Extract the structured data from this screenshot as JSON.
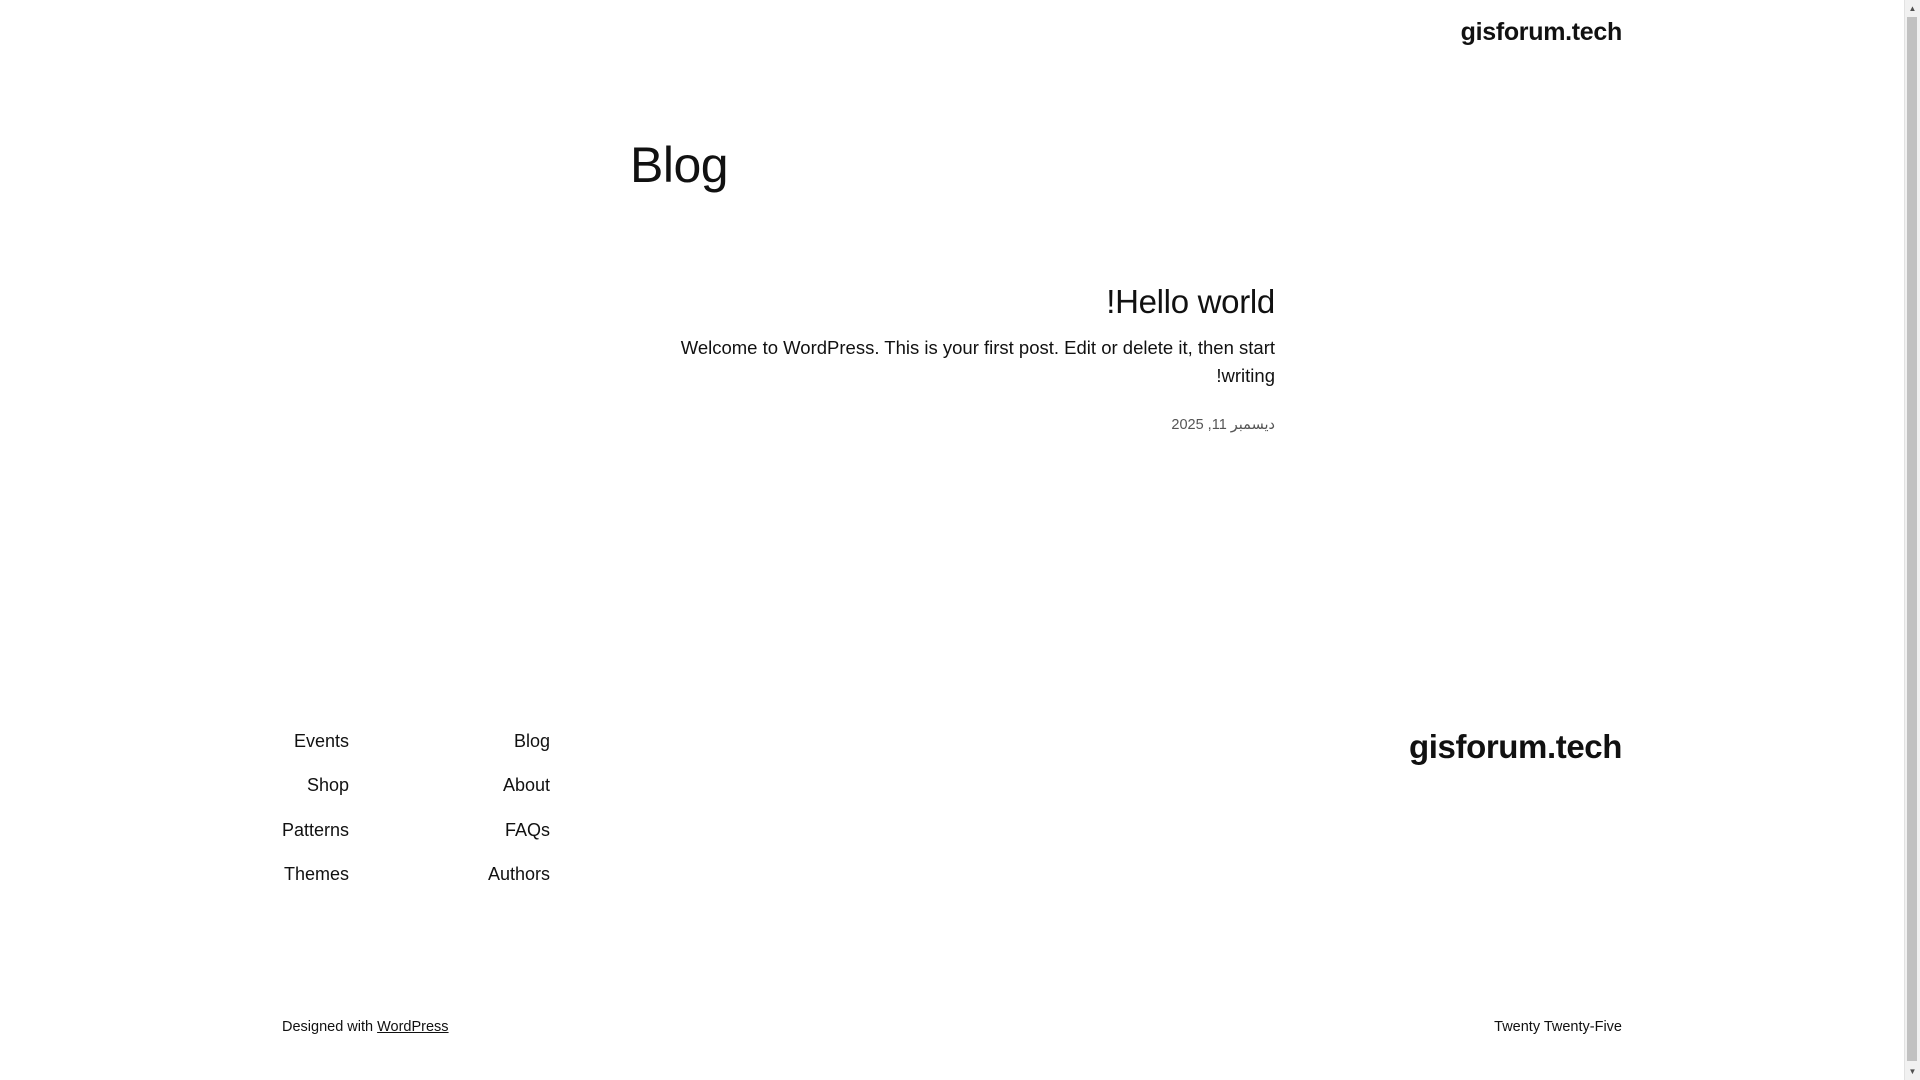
{
  "header": {
    "site_title": "gisforum.tech"
  },
  "main": {
    "page_heading": "Blog",
    "post": {
      "title": "Hello world!",
      "excerpt": "Welcome to WordPress. This is your first post. Edit or delete it, then start writing!",
      "date": "دیسمبر 11, 2025"
    }
  },
  "footer": {
    "site_title": "gisforum.tech",
    "nav_col_a": [
      "Blog",
      "About",
      "FAQs",
      "Authors"
    ],
    "nav_col_b": [
      "Events",
      "Shop",
      "Patterns",
      "Themes"
    ],
    "designed_with_prefix": "Designed with ",
    "designed_with_link": "WordPress",
    "theme_name": "Twenty Twenty-Five"
  },
  "scrollbar": {
    "up_icon": "▲",
    "down_icon": "▼"
  }
}
